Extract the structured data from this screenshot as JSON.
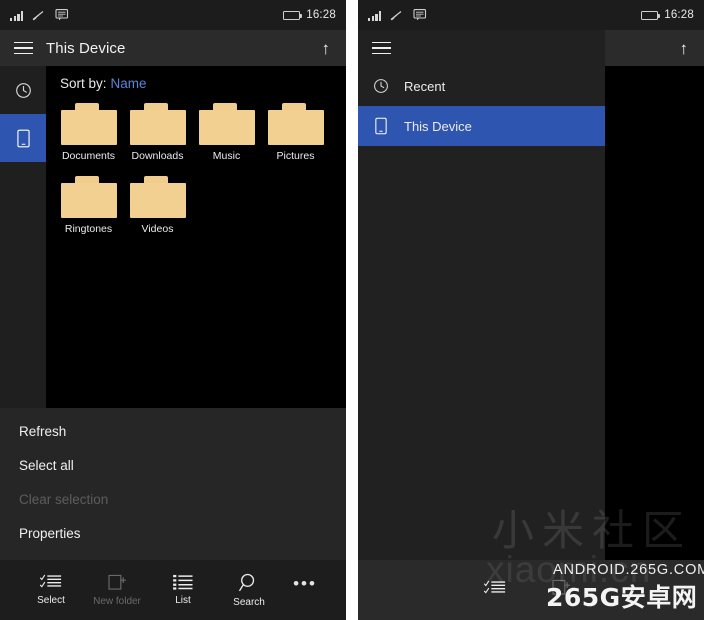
{
  "status_bar": {
    "time": "16:28",
    "icons": [
      "signal-bars-icon",
      "wifi-icon",
      "message-icon",
      "battery-icon"
    ]
  },
  "colors": {
    "accent_blue": "#2e55b0",
    "link_blue": "#5b84d8",
    "folder_tan": "#f2d092",
    "app_bar": "#2b2b2b",
    "content_bg": "#000000",
    "menu_bg": "#262626",
    "command_bar": "#1d1d1d"
  },
  "left_panel": {
    "app_bar": {
      "menu_icon": "hamburger-icon",
      "title": "This Device",
      "up_icon": "up-arrow-icon"
    },
    "rail": [
      {
        "icon": "clock-icon",
        "name": "recent",
        "active": false
      },
      {
        "icon": "device-icon",
        "name": "this-device",
        "active": true
      }
    ],
    "sort": {
      "label": "Sort by:",
      "value": "Name"
    },
    "folders": [
      {
        "name": "Documents"
      },
      {
        "name": "Downloads"
      },
      {
        "name": "Music"
      },
      {
        "name": "Pictures"
      },
      {
        "name": "Ringtones"
      },
      {
        "name": "Videos"
      }
    ],
    "context_menu": [
      {
        "label": "Refresh",
        "disabled": false
      },
      {
        "label": "Select all",
        "disabled": false
      },
      {
        "label": "Clear selection",
        "disabled": true
      },
      {
        "label": "Properties",
        "disabled": false
      }
    ],
    "command_bar": [
      {
        "label": "Select",
        "icon": "select-checklist-icon",
        "disabled": false
      },
      {
        "label": "New folder",
        "icon": "new-folder-icon",
        "disabled": true
      },
      {
        "label": "List",
        "icon": "list-view-icon",
        "disabled": false
      },
      {
        "label": "Search",
        "icon": "search-icon",
        "disabled": false
      }
    ],
    "overflow_label": "•••"
  },
  "right_panel": {
    "app_bar": {
      "menu_icon": "hamburger-icon",
      "title": "",
      "up_icon": "up-arrow-icon"
    },
    "drawer": [
      {
        "label": "Recent",
        "icon": "clock-icon",
        "active": false
      },
      {
        "label": "This Device",
        "icon": "device-icon",
        "active": true
      }
    ],
    "command_bar": [
      {
        "label": "",
        "icon": "select-checklist-icon",
        "disabled": false
      },
      {
        "label": "",
        "icon": "new-folder-icon",
        "disabled": true
      }
    ]
  },
  "watermarks": {
    "xiaomi_cn": "小米社区",
    "xiaomi_pinyin": "xiaomi.cn",
    "android_site": "ANDROID.265G.COM",
    "site_cn": "265G安卓网"
  }
}
